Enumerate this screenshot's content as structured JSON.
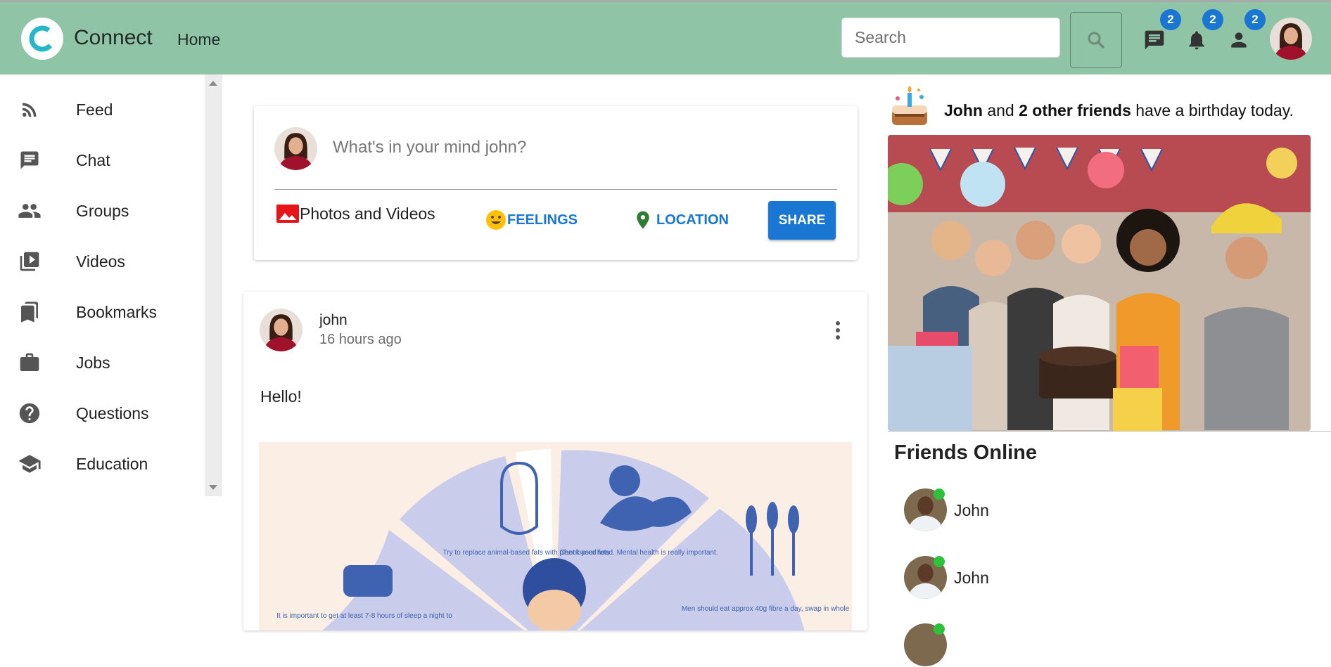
{
  "header": {
    "brand": "Connect",
    "home_link": "Home",
    "search_placeholder": "Search",
    "badges": {
      "messages": "2",
      "notifications": "2",
      "friend_requests": "2"
    },
    "accent_color": "#8fc4a7"
  },
  "sidebar": {
    "items": [
      {
        "label": "Feed",
        "icon": "rss-feed-icon"
      },
      {
        "label": "Chat",
        "icon": "chat-icon"
      },
      {
        "label": "Groups",
        "icon": "groups-icon"
      },
      {
        "label": "Videos",
        "icon": "video-library-icon"
      },
      {
        "label": "Bookmarks",
        "icon": "bookmarks-icon"
      },
      {
        "label": "Jobs",
        "icon": "briefcase-icon"
      },
      {
        "label": "Questions",
        "icon": "help-circle-icon"
      },
      {
        "label": "Education",
        "icon": "school-icon"
      }
    ]
  },
  "share": {
    "placeholder": "What's in your mind john?",
    "photos_label": "Photos and Videos",
    "feelings_label": "FEELINGS",
    "location_label": "LOCATION",
    "share_button": "SHARE"
  },
  "post": {
    "username": "john",
    "time": "16 hours ago",
    "text": "Hello!",
    "image_captions": [
      "Try to replace animal-based fats with plant-based fats",
      "Check your head. Mental health is really important.",
      "It is important to get at least 7-8 hours of sleep a night to",
      "Men should eat approx 40g fibre a day, swap in whole"
    ]
  },
  "birthday": {
    "name": "John",
    "connector": " and ",
    "others": "2 other friends",
    "suffix": " have a birthday today."
  },
  "friends_online": {
    "title": "Friends Online",
    "friends": [
      {
        "name": "John"
      },
      {
        "name": "John"
      }
    ]
  }
}
